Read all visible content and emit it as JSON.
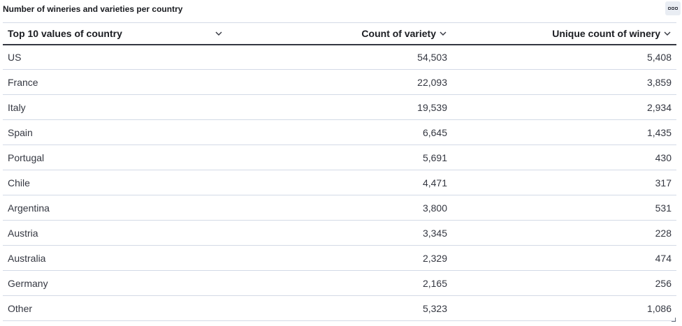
{
  "panel": {
    "title": "Number of wineries and varieties per country"
  },
  "table": {
    "columns": [
      {
        "label": "Top 10 values of country"
      },
      {
        "label": "Count of variety"
      },
      {
        "label": "Unique count of winery"
      }
    ],
    "rows": [
      {
        "country": "US",
        "variety_count": "54,503",
        "winery_count": "5,408"
      },
      {
        "country": "France",
        "variety_count": "22,093",
        "winery_count": "3,859"
      },
      {
        "country": "Italy",
        "variety_count": "19,539",
        "winery_count": "2,934"
      },
      {
        "country": "Spain",
        "variety_count": "6,645",
        "winery_count": "1,435"
      },
      {
        "country": "Portugal",
        "variety_count": "5,691",
        "winery_count": "430"
      },
      {
        "country": "Chile",
        "variety_count": "4,471",
        "winery_count": "317"
      },
      {
        "country": "Argentina",
        "variety_count": "3,800",
        "winery_count": "531"
      },
      {
        "country": "Austria",
        "variety_count": "3,345",
        "winery_count": "228"
      },
      {
        "country": "Australia",
        "variety_count": "2,329",
        "winery_count": "474"
      },
      {
        "country": "Germany",
        "variety_count": "2,165",
        "winery_count": "256"
      },
      {
        "country": "Other",
        "variety_count": "5,323",
        "winery_count": "1,086"
      }
    ]
  },
  "icons": {
    "panel_options": "ellipsis-icon",
    "sort": "chevron-down-icon",
    "resize": "resize-corner-icon"
  }
}
